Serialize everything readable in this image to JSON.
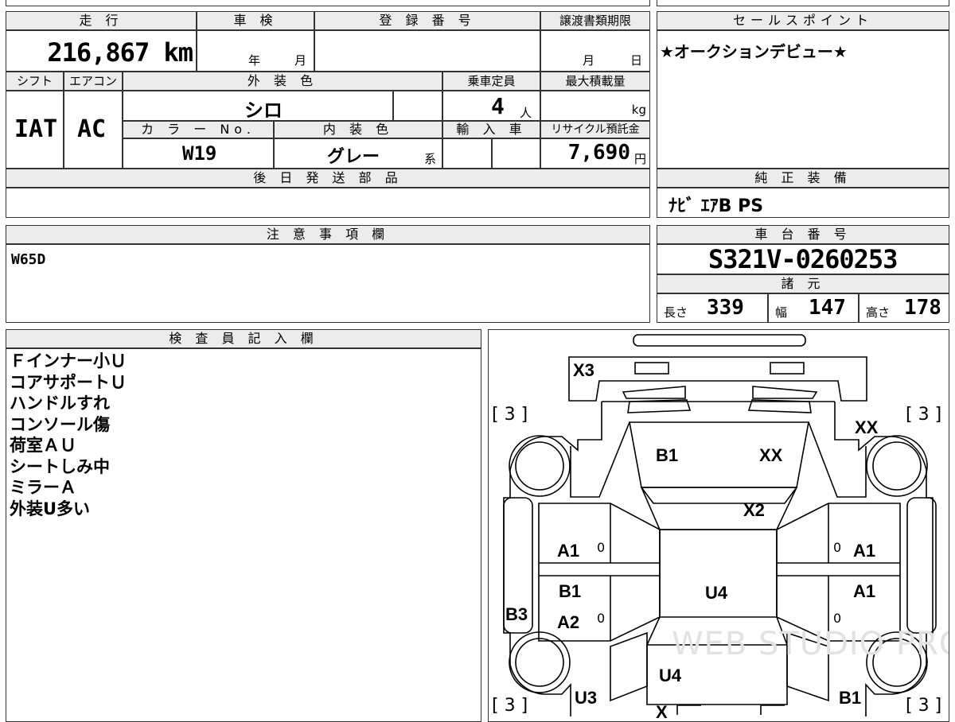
{
  "header": {
    "mileage_label": "走 行",
    "mileage_value": "216,867 km",
    "inspection_label": "車 検",
    "year_unit": "年",
    "month_unit": "月",
    "registration_label": "登 録 番 号",
    "transfer_label": "譲渡書類期限",
    "transfer_month": "月",
    "transfer_day": "日",
    "shift_label": "シフト",
    "shift_value": "IAT",
    "ac_label": "エアコン",
    "ac_value": "AC",
    "exterior_label": "外 装 色",
    "exterior_value": "シロ",
    "capacity_label": "乗車定員",
    "capacity_value": "4",
    "capacity_unit": "人",
    "load_label": "最大積載量",
    "load_unit": "kg",
    "color_no_label": "カ ラ ー No.",
    "color_no_value": "W19",
    "interior_label": "内 装 色",
    "interior_value": "グレー",
    "interior_suffix": "系",
    "import_label": "輸 入 車",
    "recycle_label": "リサイクル預託金",
    "recycle_value": "7,690",
    "recycle_unit": "円",
    "later_parts_label": "後 日 発 送 部 品"
  },
  "sales": {
    "label": "セールスポイント",
    "value": "★オークションデビュー★"
  },
  "genuine": {
    "label": "純 正 装 備",
    "value": "ﾅﾋﾞ ｴｱB PS"
  },
  "notes": {
    "label": "注 意 事 項 欄",
    "value": "W65D"
  },
  "chassis": {
    "label": "車 台 番 号",
    "value": "S321V-0260253"
  },
  "specs": {
    "label": "諸 元",
    "length_label": "長さ",
    "length_value": "339",
    "width_label": "幅",
    "width_value": "147",
    "height_label": "高さ",
    "height_value": "178"
  },
  "inspector": {
    "label": "検 査 員 記 入 欄",
    "lines": [
      "Ｆインナー小Ｕ",
      "コアサポートＵ",
      "ハンドルすれ",
      "コンソール傷",
      "荷室ＡＵ",
      "シートしみ中",
      "ミラーＡ",
      "外装U多い"
    ]
  },
  "diagram": {
    "marks": {
      "front_top": "X3",
      "hood_left": "B1",
      "hood_right": "XX",
      "fender_right": "XX",
      "windshield": "X2",
      "fl_door": "A1",
      "fr_door": "A1",
      "rl_door1": "B1",
      "rr_door": "A1",
      "rl_door2": "A2",
      "left_side": "B3",
      "roof": "U4",
      "rear_glass": "U4",
      "rear_left": "U3",
      "rear_right": "B1",
      "rear_center": "X",
      "tire_fl": "[ 3 ]",
      "tire_fr": "[ 3 ]",
      "tire_rl": "[ 3 ]",
      "tire_rr": "[ 3 ]",
      "zero": "0"
    },
    "watermark": "WEB STUDIO PRO"
  }
}
